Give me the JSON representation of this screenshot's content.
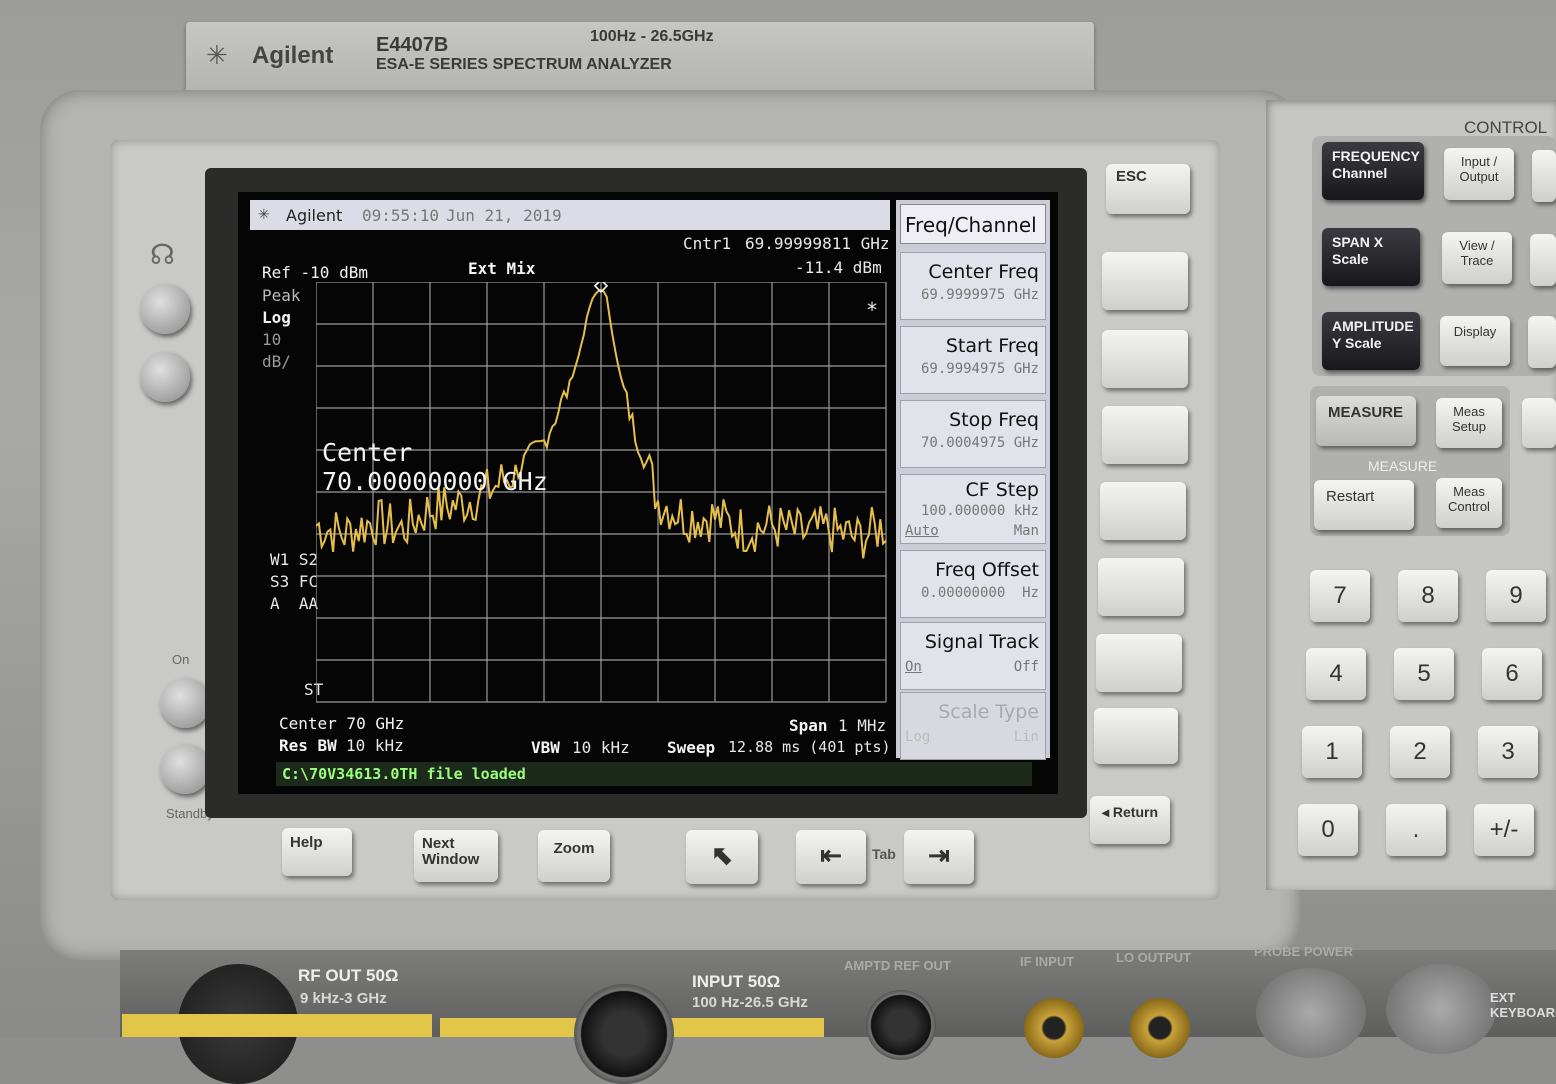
{
  "nameplate": {
    "brand": "Agilent",
    "model": "E4407B",
    "range": "100Hz - 26.5GHz",
    "series": "ESA-E SERIES SPECTRUM ANALYZER"
  },
  "screen": {
    "header": {
      "brand": "Agilent",
      "time": "09:55:10",
      "date": "Jun 21, 2019"
    },
    "marker": {
      "label": "Cntr1",
      "freq": "69.99999811 GHz",
      "level": "-11.4 dBm"
    },
    "ref": "Ref -10 dBm",
    "ext_mix": "Ext Mix",
    "detector": "Peak",
    "scale_type": "Log",
    "scale_value": "10",
    "scale_unit": "dB/",
    "star": "*",
    "annotation_center_label": "Center",
    "annotation_center_value": "70.00000000 GHz",
    "side_labels": [
      "W1 S2",
      "S3 FC",
      "A  AA"
    ],
    "st_label": "ST",
    "footer": {
      "center": "Center 70 GHz",
      "span_label": "Span",
      "span_value": "1 MHz",
      "res_bw_label": "Res BW",
      "res_bw_value": "10 kHz",
      "vbw_label": "VBW",
      "vbw_value": "10 kHz",
      "sweep_label": "Sweep",
      "sweep_value": "12.88 ms (401 pts)"
    },
    "status_line": "C:\\70V34613.0TH file loaded",
    "menu_title": "Freq/Channel",
    "softkeys": [
      {
        "title": "Center Freq",
        "value": "69.9999975 GHz"
      },
      {
        "title": "Start Freq",
        "value": "69.9994975 GHz"
      },
      {
        "title": "Stop Freq",
        "value": "70.0004975 GHz"
      },
      {
        "title": "CF Step",
        "value": "100.000000 kHz",
        "left": "Auto",
        "right": "Man"
      },
      {
        "title": "Freq Offset",
        "value": "0.00000000  Hz"
      },
      {
        "title": "Signal Track",
        "left": "On",
        "right": "Off"
      },
      {
        "title": "Scale Type",
        "left": "Log",
        "right": "Lin"
      }
    ]
  },
  "chart_data": {
    "type": "line",
    "title": "",
    "xlabel": "",
    "ylabel": "",
    "center_freq_ghz": 70.0,
    "span_mhz": 1,
    "x_unit": "MHz offset from center",
    "xlim": [
      -0.5,
      0.5
    ],
    "ylim": [
      -110,
      -10
    ],
    "y_unit": "dBm",
    "grid": true,
    "series": [
      {
        "x": [
          -0.5,
          -0.45,
          -0.4,
          -0.35,
          -0.3,
          -0.25,
          -0.2,
          -0.15,
          -0.1,
          -0.08,
          -0.06,
          -0.04,
          -0.03,
          -0.02,
          -0.01,
          0.0,
          0.01,
          0.02,
          0.03,
          0.04,
          0.06,
          0.08,
          0.1,
          0.15,
          0.2,
          0.25,
          0.3,
          0.35,
          0.4,
          0.45,
          0.5
        ],
        "y": [
          -68,
          -70,
          -67,
          -69,
          -64,
          -63,
          -60,
          -55,
          -48,
          -42,
          -36,
          -28,
          -22,
          -16,
          -13,
          -11.4,
          -14,
          -22,
          -30,
          -36,
          -46,
          -53,
          -62,
          -66,
          -66,
          -69,
          -68,
          -70,
          -69,
          -71,
          -68
        ]
      }
    ]
  },
  "softkey_side": {
    "esc": "ESC",
    "return": "Return"
  },
  "bottom_keys": {
    "help": "Help",
    "next_window": "Next Window",
    "zoom": "Zoom",
    "tab": "Tab"
  },
  "control": {
    "title": "CONTROL",
    "frequency": "FREQUENCY Channel",
    "span": "SPAN X Scale",
    "amplitude": "AMPLITUDE Y Scale",
    "input_output": "Input / Output",
    "view_trace": "View / Trace",
    "display": "Display",
    "measure": "MEASURE",
    "meas_setup": "Meas Setup",
    "measure_group": "MEASURE",
    "restart": "Restart",
    "meas_control": "Meas Control"
  },
  "keypad": [
    "7",
    "8",
    "9",
    "4",
    "5",
    "6",
    "1",
    "2",
    "3",
    "0",
    ".",
    "+/-"
  ],
  "power": {
    "on": "On",
    "standby": "Standby"
  },
  "ports": {
    "rf_out": "RF OUT 50Ω",
    "rf_out_range": "9 kHz-3 GHz",
    "input": "INPUT 50Ω",
    "input_range": "100 Hz-26.5 GHz",
    "amptd_ref_out": "AMPTD REF OUT",
    "if_input": "IF INPUT",
    "lo_output": "LO OUTPUT",
    "probe_power": "PROBE POWER",
    "ext_keyboard": "EXT KEYBOARD"
  }
}
